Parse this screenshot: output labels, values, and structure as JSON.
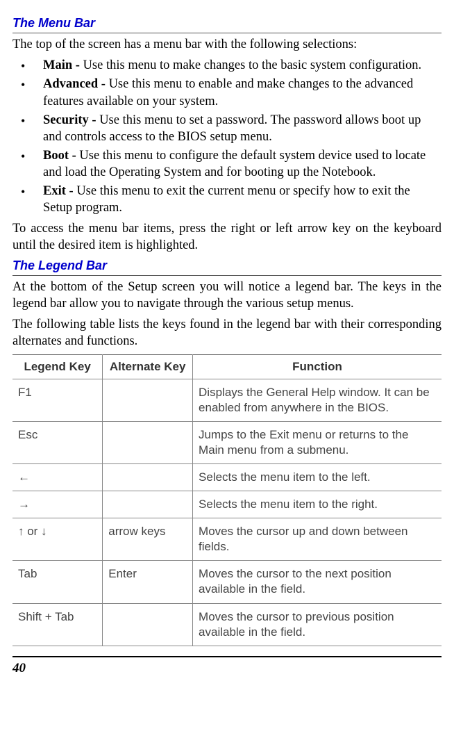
{
  "section1": {
    "title": "The Menu Bar",
    "intro": "The top of the screen has a menu bar with the following selections:",
    "bullets": [
      {
        "label": "Main - ",
        "desc": "Use this menu to make changes to the basic system configuration."
      },
      {
        "label": "Advanced - ",
        "desc": "Use this menu to enable and make changes to the advanced features available on your system."
      },
      {
        "label": "Security - ",
        "desc": "Use this menu to set a password.  The password allows boot up and controls access to the BIOS setup menu."
      },
      {
        "label": "Boot - ",
        "desc": "Use this menu to configure the default system device used to locate and load the Operating System and for booting up the Notebook."
      },
      {
        "label": "Exit - ",
        "desc": "Use this menu to exit the current menu or specify how to exit the Setup program."
      }
    ],
    "outro": "To access the menu bar items, press the right or left arrow key on the keyboard until the desired item is highlighted."
  },
  "section2": {
    "title": "The Legend Bar",
    "para1": "At the bottom of the Setup screen you will notice a legend bar.  The keys in the legend bar allow you to navigate through the various setup menus.",
    "para2": "The following table lists the keys found in the legend bar with their corresponding alternates and functions."
  },
  "table": {
    "headers": {
      "col1": "Legend Key",
      "col2": "Alternate Key",
      "col3": "Function"
    },
    "rows": [
      {
        "key": "F1",
        "alt": "",
        "func": "Displays the General Help window.  It can be enabled from anywhere in the BIOS."
      },
      {
        "key": "Esc",
        "alt": "",
        "func": "Jumps to the Exit menu or returns to the Main menu from a submenu."
      },
      {
        "key": "←",
        "alt": "",
        "func": "Selects the menu item to the left."
      },
      {
        "key": "→",
        "alt": "",
        "func": "Selects the menu item to the right."
      },
      {
        "key": "↑ or ↓",
        "alt": "arrow keys",
        "func": "Moves the cursor up and down between fields."
      },
      {
        "key": "Tab",
        "alt": "Enter",
        "func": "Moves the cursor to the next position available in the field."
      },
      {
        "key": "Shift + Tab",
        "alt": "",
        "func": "Moves the cursor to previous position available in the field."
      }
    ]
  },
  "pageNumber": "40"
}
